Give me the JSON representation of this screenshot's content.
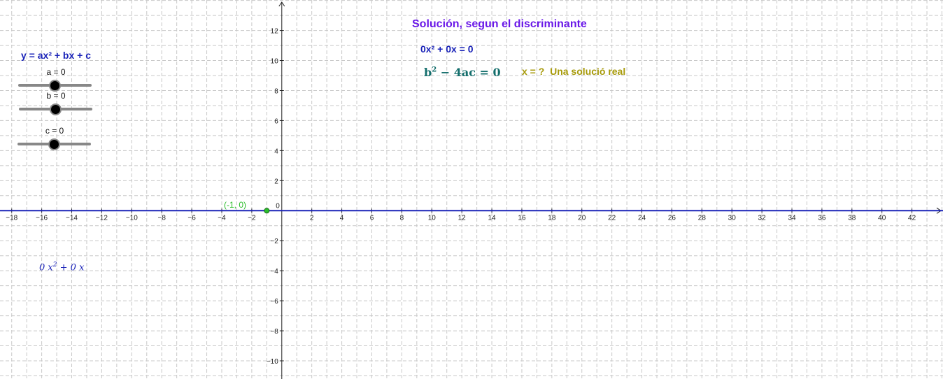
{
  "graph": {
    "x_range": [
      -18.78,
      44.07
    ],
    "y_range": [
      -11.21,
      14.03
    ],
    "x_ticks": [
      -18,
      -16,
      -14,
      -12,
      -10,
      -8,
      -6,
      -4,
      -2,
      2,
      4,
      6,
      8,
      10,
      12,
      14,
      16,
      18,
      20,
      22,
      24,
      26,
      28,
      30,
      32,
      34,
      36,
      38,
      40,
      42
    ],
    "y_ticks": [
      -10,
      -8,
      -6,
      -4,
      -2,
      2,
      4,
      6,
      8,
      10,
      12
    ],
    "origin_label": "0",
    "grid": true,
    "axis_color": "#222222",
    "grid_color": "#c8c8c8",
    "function_color": "#1a23b8",
    "point_color": "#2bbd2b",
    "point": {
      "x": -1,
      "y": 0,
      "label": "(-1, 0)"
    }
  },
  "panel": {
    "equation": "y = ax² + bx + c",
    "sliders": [
      {
        "id": "a",
        "label": "a = 0",
        "value": 0,
        "min": -5,
        "max": 5
      },
      {
        "id": "b",
        "label": "b = 0",
        "value": 0,
        "min": -5,
        "max": 5
      },
      {
        "id": "c",
        "label": "c = 0",
        "value": 0,
        "min": -5,
        "max": 5
      }
    ]
  },
  "solution": {
    "title": "Solución, segun el discriminante",
    "equation": "0x² + 0x = 0",
    "discriminant_b": "b",
    "discriminant_exp": "2",
    "discriminant_rest": " −  4ac = 0",
    "x_label": "x  = ?",
    "solution_text": "Una solució real"
  },
  "function_label": {
    "coef_a": "0",
    "var_a": "x",
    "exp": "2",
    "plus": " + ",
    "coef_b": "0",
    "var_b": "x"
  }
}
